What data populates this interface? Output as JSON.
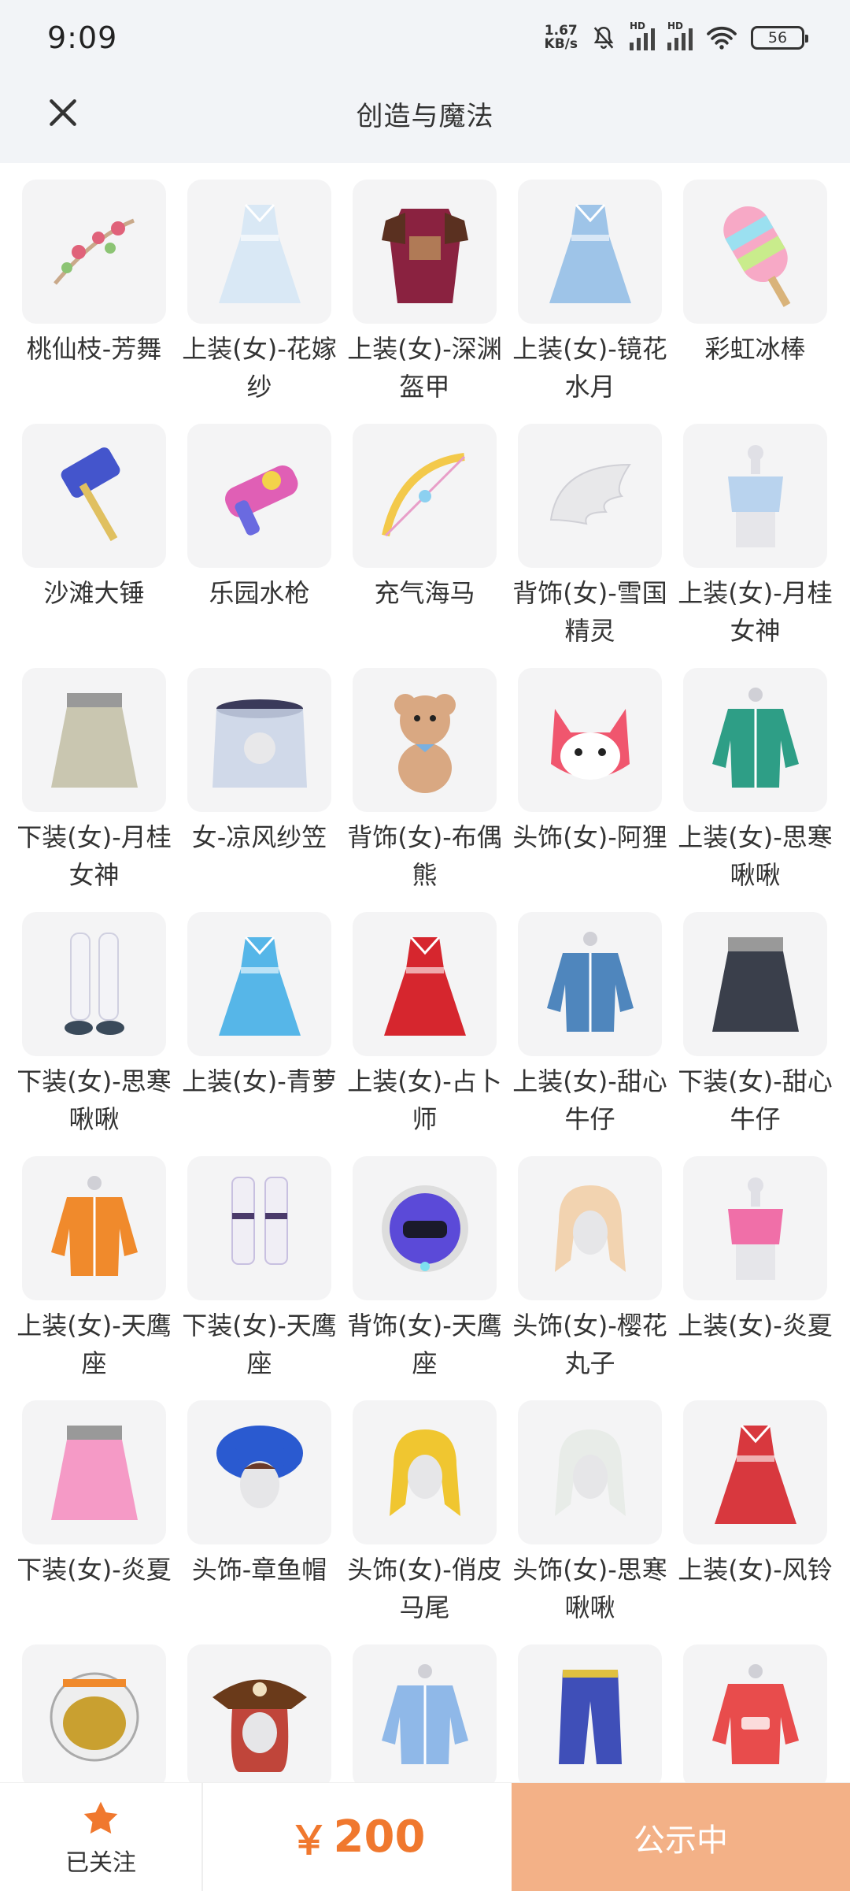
{
  "status_bar": {
    "time": "9:09",
    "net_speed_value": "1.67",
    "net_speed_unit": "KB/s",
    "signal_label": "HD",
    "battery": "56"
  },
  "header": {
    "title": "创造与魔法"
  },
  "items": [
    {
      "label": "桃仙枝-芳舞",
      "icon": "branch-icon",
      "color": "#e0627a"
    },
    {
      "label": "上装(女)-花嫁纱",
      "icon": "dress-icon",
      "color": "#d9e8f5"
    },
    {
      "label": "上装(女)-深渊盔甲",
      "icon": "armor-icon",
      "color": "#8a2240"
    },
    {
      "label": "上装(女)-镜花水月",
      "icon": "dress-icon",
      "color": "#9ec4e8"
    },
    {
      "label": "彩虹冰棒",
      "icon": "popsicle-icon",
      "color": "#f7a9c6"
    },
    {
      "label": "沙滩大锤",
      "icon": "hammer-icon",
      "color": "#4455cc"
    },
    {
      "label": "乐园水枪",
      "icon": "water-gun-icon",
      "color": "#e05fb5"
    },
    {
      "label": "充气海马",
      "icon": "bow-icon",
      "color": "#f3c94a"
    },
    {
      "label": "背饰(女)-雪国精灵",
      "icon": "wings-icon",
      "color": "#e8e8ea"
    },
    {
      "label": "上装(女)-月桂女神",
      "icon": "top-icon",
      "color": "#b9d3ee"
    },
    {
      "label": "下装(女)-月桂女神",
      "icon": "skirt-icon",
      "color": "#c9c6b0"
    },
    {
      "label": "女-凉风纱笠",
      "icon": "veil-hat-icon",
      "color": "#c9d3e6"
    },
    {
      "label": "背饰(女)-布偶熊",
      "icon": "teddy-bear-icon",
      "color": "#d9a882"
    },
    {
      "label": "头饰(女)-阿狸",
      "icon": "fox-mask-icon",
      "color": "#f0566e"
    },
    {
      "label": "上装(女)-思寒啾啾",
      "icon": "jacket-icon",
      "color": "#2e9e86"
    },
    {
      "label": "下装(女)-思寒啾啾",
      "icon": "legs-icon",
      "color": "#f3f3f7"
    },
    {
      "label": "上装(女)-青萝",
      "icon": "dress-icon",
      "color": "#56b6e8"
    },
    {
      "label": "上装(女)-占卜师",
      "icon": "dress-icon",
      "color": "#d6262e"
    },
    {
      "label": "上装(女)-甜心牛仔",
      "icon": "jacket-icon",
      "color": "#4f86bd"
    },
    {
      "label": "下装(女)-甜心牛仔",
      "icon": "skirt-icon",
      "color": "#3a3f4b"
    },
    {
      "label": "上装(女)-天鹰座",
      "icon": "jacket-icon",
      "color": "#f08a2c"
    },
    {
      "label": "下装(女)-天鹰座",
      "icon": "boots-icon",
      "color": "#f0eef5"
    },
    {
      "label": "背饰(女)-天鹰座",
      "icon": "backpack-icon",
      "color": "#5b4ad8"
    },
    {
      "label": "头饰(女)-樱花丸子",
      "icon": "hair-icon",
      "color": "#f2d3b0"
    },
    {
      "label": "上装(女)-炎夏",
      "icon": "top-icon",
      "color": "#f06fa8"
    },
    {
      "label": "下装(女)-炎夏",
      "icon": "skirt-icon",
      "color": "#f59ac6"
    },
    {
      "label": "头饰-章鱼帽",
      "icon": "octopus-hat-icon",
      "color": "#2a5ad0"
    },
    {
      "label": "头饰(女)-俏皮马尾",
      "icon": "hair-icon",
      "color": "#f0c630"
    },
    {
      "label": "头饰(女)-思寒啾啾",
      "icon": "hair-icon",
      "color": "#e8ece8"
    },
    {
      "label": "上装(女)-风铃",
      "icon": "dress-icon",
      "color": "#d8383e"
    },
    {
      "label": "",
      "icon": "helmet-icon",
      "color": "#c9a030"
    },
    {
      "label": "",
      "icon": "pirate-hat-icon",
      "color": "#c0453a"
    },
    {
      "label": "",
      "icon": "jacket-icon",
      "color": "#8fb8e8"
    },
    {
      "label": "",
      "icon": "pants-icon",
      "color": "#3f4fb8"
    },
    {
      "label": "",
      "icon": "hoodie-icon",
      "color": "#e84c4c"
    }
  ],
  "bottom_bar": {
    "follow_label": "已关注",
    "currency": "￥",
    "price": "200",
    "publish_label": "公示中"
  },
  "colors": {
    "accent": "#f0782e",
    "button": "#f3b187",
    "header_bg": "#f2f4f7"
  }
}
